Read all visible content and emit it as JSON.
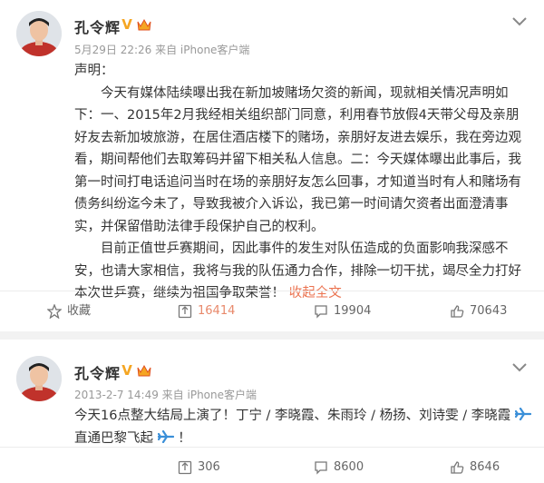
{
  "posts": [
    {
      "author": "孔令辉",
      "verified_badge": "V",
      "meta": "5月29日 22:26 来自 iPhone客户端",
      "lines": [
        "声明：",
        "今天有媒体陆续曝出我在新加坡赌场欠资的新闻，现就相关情况声明如下：一、2015年2月我经相关组织部门同意，利用春节放假4天带父母及亲朋好友去新加坡旅游，在居住酒店楼下的赌场，亲朋好友进去娱乐，我在旁边观看，期间帮他们去取筹码并留下相关私人信息。二：今天媒体曝出此事后，我第一时间打电话追问当时在场的亲朋好友怎么回事，才知道当时有人和赌场有债务纠纷迄今未了，导致我被介入诉讼，我已第一时间请欠资者出面澄清事实，并保留借助法律手段保护自己的权利。",
        "目前正值世乒赛期间，因此事件的发生对队伍造成的负面影响我深感不安，也请大家相信，我将与我的队伍通力合作，排除一切干扰，竭尽全力打好本次世乒赛，继续为祖国争取荣誉！"
      ],
      "expand_link": "收起全文",
      "actions": {
        "favorite": "收藏",
        "repost": "16414",
        "comment": "19904",
        "like": "70643"
      }
    },
    {
      "author": "孔令辉",
      "verified_badge": "V",
      "meta": "2013-2-7 14:49 来自 iPhone客户端",
      "text_a": "今天16点整大结局上演了！丁宁 / 李晓霞、朱雨玲 / 杨扬、刘诗雯 / 李晓霞",
      "text_b": "直通巴黎飞起",
      "text_c": "！",
      "actions": {
        "repost": "306",
        "comment": "8600",
        "like": "8646"
      }
    }
  ],
  "colors": {
    "link": "#eb7350",
    "badge": "#f5a623",
    "repost_highlight": "#e8896b",
    "meta": "#999999"
  },
  "icons": [
    "avatar",
    "verified-v-icon",
    "crown-icon",
    "chevron-down-icon",
    "star-icon",
    "repost-icon",
    "comment-icon",
    "like-icon",
    "airplane-icon"
  ]
}
